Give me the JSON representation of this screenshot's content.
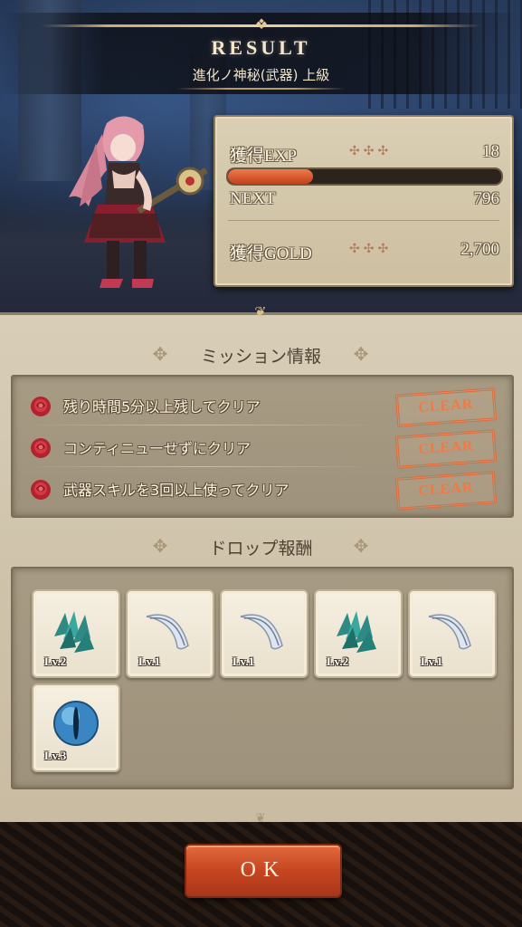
{
  "header": {
    "title": "RESULT",
    "stage": "進化ノ神秘(武器) 上級"
  },
  "stats": {
    "exp_label": "獲得EXP",
    "exp_value": "18",
    "exp_progress": 0.31,
    "next_label": "NEXT",
    "next_value": "796",
    "gold_label": "獲得GOLD",
    "gold_value": "2,700",
    "crosses": "✣✣✣"
  },
  "missions": {
    "heading": "ミッション情報",
    "items": [
      {
        "text": "残り時間5分以上残してクリア",
        "status": "CLEAR"
      },
      {
        "text": "コンティニューせずにクリア",
        "status": "CLEAR"
      },
      {
        "text": "武器スキルを3回以上使ってクリア",
        "status": "CLEAR"
      }
    ]
  },
  "drops": {
    "heading": "ドロップ報酬",
    "items": [
      {
        "icon": "crystal-scale-icon",
        "level": "Lv.2"
      },
      {
        "icon": "feather-icon",
        "level": "Lv.1"
      },
      {
        "icon": "feather-icon",
        "level": "Lv.1"
      },
      {
        "icon": "crystal-scale-icon",
        "level": "Lv.2"
      },
      {
        "icon": "feather-icon",
        "level": "Lv.1"
      },
      {
        "icon": "eye-orb-icon",
        "level": "Lv.3"
      }
    ]
  },
  "ok_button": "OK",
  "colors": {
    "accent": "#c6451f",
    "parchment": "#d8ceb8",
    "clear_stamp": "#e06a3a"
  }
}
